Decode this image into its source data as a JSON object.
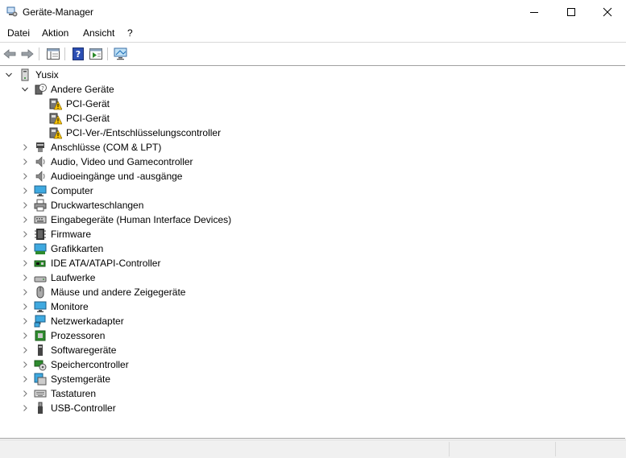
{
  "window": {
    "title": "Geräte-Manager"
  },
  "menu": [
    "Datei",
    "Aktion",
    "Ansicht",
    "?"
  ],
  "toolbar": {
    "icons": [
      "back-arrow-icon",
      "forward-arrow-icon",
      "properties-view-icon",
      "help-icon",
      "action-view-icon",
      "monitor-scan-icon"
    ]
  },
  "tree": {
    "root": {
      "label": "Yusix",
      "icon": "computer-tower-icon",
      "expanded": true
    },
    "groups": [
      {
        "label": "Andere Geräte",
        "icon": "unknown-device-icon",
        "expanded": true,
        "children": [
          {
            "label": "PCI-Gerät",
            "icon": "warning-device-icon"
          },
          {
            "label": "PCI-Gerät",
            "icon": "warning-device-icon"
          },
          {
            "label": "PCI-Ver-/Entschlüsselungscontroller",
            "icon": "warning-device-icon"
          }
        ]
      },
      {
        "label": "Anschlüsse (COM & LPT)",
        "icon": "port-icon",
        "expanded": false
      },
      {
        "label": "Audio, Video und Gamecontroller",
        "icon": "speaker-icon",
        "expanded": false
      },
      {
        "label": "Audioeingänge und -ausgänge",
        "icon": "speaker-icon",
        "expanded": false
      },
      {
        "label": "Computer",
        "icon": "monitor-icon",
        "expanded": false
      },
      {
        "label": "Druckwarteschlangen",
        "icon": "printer-icon",
        "expanded": false
      },
      {
        "label": "Eingabegeräte (Human Interface Devices)",
        "icon": "keyboard-hid-icon",
        "expanded": false
      },
      {
        "label": "Firmware",
        "icon": "chip-icon",
        "expanded": false
      },
      {
        "label": "Grafikkarten",
        "icon": "display-adapter-icon",
        "expanded": false
      },
      {
        "label": "IDE ATA/ATAPI-Controller",
        "icon": "ide-controller-icon",
        "expanded": false
      },
      {
        "label": "Laufwerke",
        "icon": "drive-icon",
        "expanded": false
      },
      {
        "label": "Mäuse und andere Zeigegeräte",
        "icon": "mouse-icon",
        "expanded": false
      },
      {
        "label": "Monitore",
        "icon": "monitor-icon",
        "expanded": false
      },
      {
        "label": "Netzwerkadapter",
        "icon": "network-adapter-icon",
        "expanded": false
      },
      {
        "label": "Prozessoren",
        "icon": "processor-icon",
        "expanded": false
      },
      {
        "label": "Softwaregeräte",
        "icon": "software-device-icon",
        "expanded": false
      },
      {
        "label": "Speichercontroller",
        "icon": "storage-controller-icon",
        "expanded": false
      },
      {
        "label": "Systemgeräte",
        "icon": "system-device-icon",
        "expanded": false
      },
      {
        "label": "Tastaturen",
        "icon": "keyboard-icon",
        "expanded": false
      },
      {
        "label": "USB-Controller",
        "icon": "usb-icon",
        "expanded": false
      }
    ]
  }
}
